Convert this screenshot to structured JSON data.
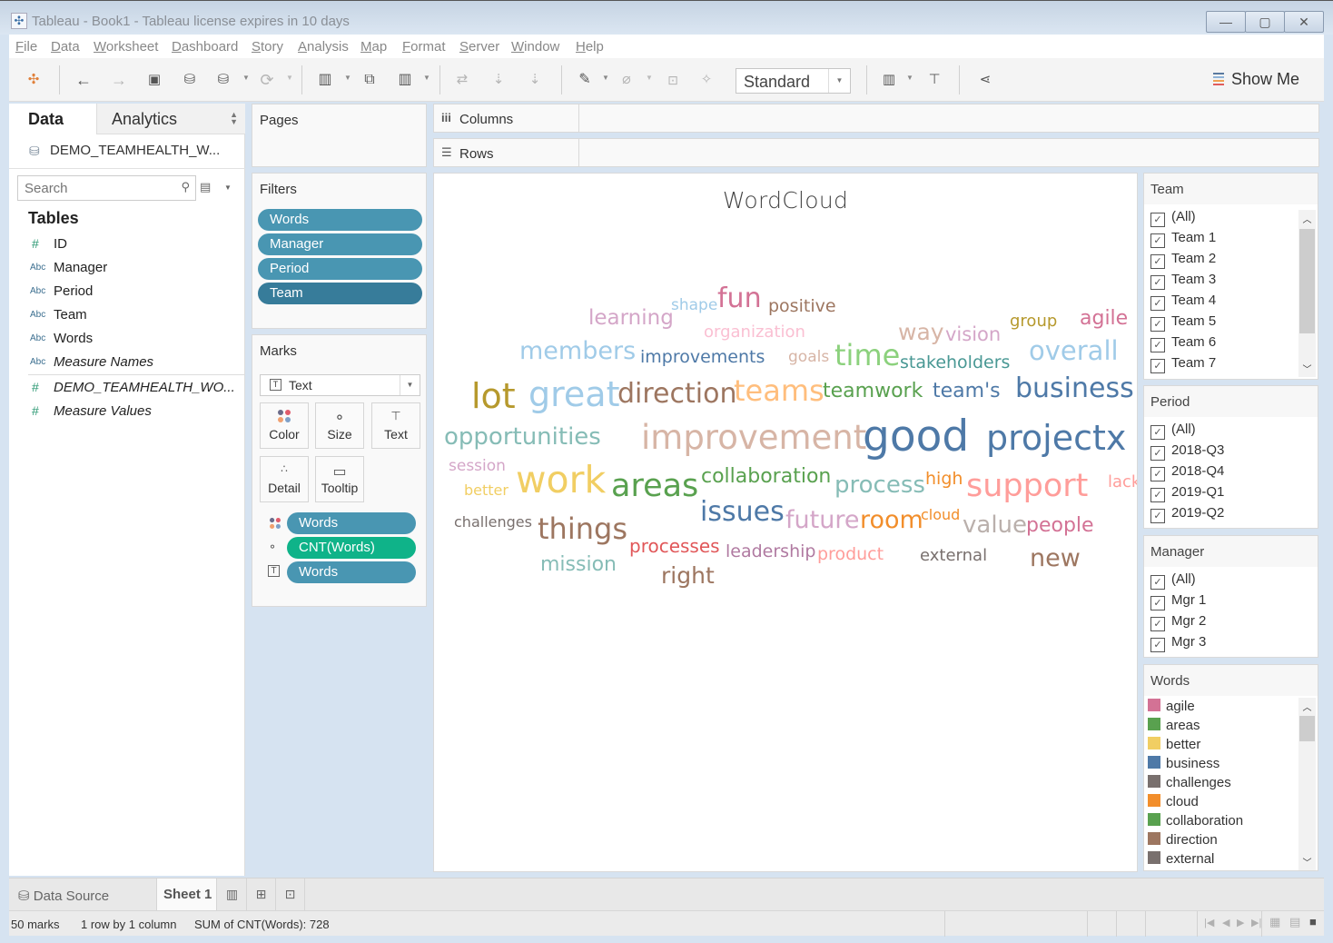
{
  "window": {
    "title": "Tableau - Book1 - Tableau license expires in 10 days",
    "app_icon": "tableau-logo-icon",
    "controls": [
      "minimize",
      "maximize",
      "close"
    ]
  },
  "menu": [
    "File",
    "Data",
    "Worksheet",
    "Dashboard",
    "Story",
    "Analysis",
    "Map",
    "Format",
    "Server",
    "Window",
    "Help"
  ],
  "toolbar": {
    "icons": [
      "tableau-logo-icon",
      "undo-icon",
      "redo-icon",
      "save-icon",
      "new-datasource-icon",
      "pause-updates-icon",
      "refresh-icon",
      "new-worksheet-icon",
      "duplicate-sheet-icon",
      "clear-sheet-icon",
      "swap-rows-columns-icon",
      "sort-ascending-icon",
      "sort-descending-icon",
      "highlight-icon",
      "group-icon",
      "label-icon",
      "pin-icon",
      "show-cards-icon",
      "presentation-icon",
      "share-icon"
    ],
    "fit_value": "Standard",
    "show_me_label": "Show Me"
  },
  "data_pane": {
    "tab_data": "Data",
    "tab_analytics": "Analytics",
    "datasource": "DEMO_TEAMHEALTH_W...",
    "search_placeholder": "Search",
    "tables_label": "Tables",
    "fields": [
      {
        "type": "#",
        "name": "ID",
        "italic": false,
        "kind": "measure"
      },
      {
        "type": "Abc",
        "name": "Manager",
        "italic": false,
        "kind": "dimension"
      },
      {
        "type": "Abc",
        "name": "Period",
        "italic": false,
        "kind": "dimension"
      },
      {
        "type": "Abc",
        "name": "Team",
        "italic": false,
        "kind": "dimension"
      },
      {
        "type": "Abc",
        "name": "Words",
        "italic": false,
        "kind": "dimension"
      },
      {
        "type": "Abc",
        "name": "Measure Names",
        "italic": true,
        "kind": "dimension"
      },
      {
        "type": "#",
        "name": "DEMO_TEAMHEALTH_WO...",
        "italic": true,
        "kind": "measure"
      },
      {
        "type": "#",
        "name": "Measure Values",
        "italic": true,
        "kind": "measure"
      }
    ]
  },
  "pages": {
    "title": "Pages"
  },
  "filters": {
    "title": "Filters",
    "pills": [
      "Words",
      "Manager",
      "Period",
      "Team"
    ]
  },
  "marks": {
    "title": "Marks",
    "mark_type": "Text",
    "buttons": [
      "Color",
      "Size",
      "Text",
      "Detail",
      "Tooltip"
    ],
    "encodings": [
      {
        "icon": "color-icon",
        "field": "Words"
      },
      {
        "icon": "size-icon",
        "field": "CNT(Words)"
      },
      {
        "icon": "text-icon",
        "field": "Words"
      }
    ]
  },
  "shelves": {
    "columns": "Columns",
    "rows": "Rows"
  },
  "viz": {
    "title": "WordCloud"
  },
  "chart_data": {
    "type": "wordcloud",
    "title": "WordCloud",
    "size_measure": "CNT(Words)",
    "color_dimension": "Words",
    "total": 728,
    "mark_count": 50,
    "words": [
      {
        "text": "good",
        "weight": 48,
        "color": "#4e79a7"
      },
      {
        "text": "projectx",
        "weight": 40,
        "color": "#4e79a7"
      },
      {
        "text": "improvement",
        "weight": 36,
        "color": "#d7b5a6"
      },
      {
        "text": "work",
        "weight": 36,
        "color": "#f1ce63"
      },
      {
        "text": "great",
        "weight": 34,
        "color": "#a0cbe8"
      },
      {
        "text": "lot",
        "weight": 34,
        "color": "#b6992d"
      },
      {
        "text": "areas",
        "weight": 34,
        "color": "#59a14f"
      },
      {
        "text": "support",
        "weight": 32,
        "color": "#ff9d9a"
      },
      {
        "text": "business",
        "weight": 28,
        "color": "#4e79a7"
      },
      {
        "text": "teams",
        "weight": 30,
        "color": "#ffbe7d"
      },
      {
        "text": "direction",
        "weight": 30,
        "color": "#9d7660"
      },
      {
        "text": "time",
        "weight": 30,
        "color": "#8cd17d"
      },
      {
        "text": "overall",
        "weight": 28,
        "color": "#a0cbe8"
      },
      {
        "text": "things",
        "weight": 30,
        "color": "#9d7660"
      },
      {
        "text": "issues",
        "weight": 28,
        "color": "#4e79a7"
      },
      {
        "text": "members",
        "weight": 26,
        "color": "#a0cbe8"
      },
      {
        "text": "opportunities",
        "weight": 26,
        "color": "#86bcb6"
      },
      {
        "text": "fun",
        "weight": 28,
        "color": "#d37295"
      },
      {
        "text": "process",
        "weight": 26,
        "color": "#86bcb6"
      },
      {
        "text": "room",
        "weight": 26,
        "color": "#f28e2b"
      },
      {
        "text": "future",
        "weight": 26,
        "color": "#d4a6c8"
      },
      {
        "text": "value",
        "weight": 26,
        "color": "#bab0ac"
      },
      {
        "text": "new",
        "weight": 26,
        "color": "#9d7660"
      },
      {
        "text": "right",
        "weight": 24,
        "color": "#9d7660"
      },
      {
        "text": "way",
        "weight": 24,
        "color": "#d7b5a6"
      },
      {
        "text": "learning",
        "weight": 22,
        "color": "#d4a6c8"
      },
      {
        "text": "agile",
        "weight": 22,
        "color": "#d37295"
      },
      {
        "text": "teamwork",
        "weight": 22,
        "color": "#59a14f"
      },
      {
        "text": "team's",
        "weight": 22,
        "color": "#4e79a7"
      },
      {
        "text": "mission",
        "weight": 22,
        "color": "#86bcb6"
      },
      {
        "text": "collaboration",
        "weight": 22,
        "color": "#59a14f"
      },
      {
        "text": "people",
        "weight": 22,
        "color": "#d37295"
      },
      {
        "text": "processes",
        "weight": 20,
        "color": "#e15759"
      },
      {
        "text": "vision",
        "weight": 20,
        "color": "#d4a6c8"
      },
      {
        "text": "positive",
        "weight": 19,
        "color": "#9d7660"
      },
      {
        "text": "stakeholders",
        "weight": 19,
        "color": "#499894"
      },
      {
        "text": "improvements",
        "weight": 19,
        "color": "#4e79a7"
      },
      {
        "text": "leadership",
        "weight": 19,
        "color": "#b07aa1"
      },
      {
        "text": "product",
        "weight": 19,
        "color": "#ff9d9a"
      },
      {
        "text": "external",
        "weight": 18,
        "color": "#79706e"
      },
      {
        "text": "group",
        "weight": 18,
        "color": "#b6992d"
      },
      {
        "text": "organization",
        "weight": 18,
        "color": "#fabfd2"
      },
      {
        "text": "high",
        "weight": 18,
        "color": "#f28e2b"
      },
      {
        "text": "lack",
        "weight": 18,
        "color": "#ff9d9a"
      },
      {
        "text": "session",
        "weight": 17,
        "color": "#d4a6c8"
      },
      {
        "text": "shape",
        "weight": 17,
        "color": "#a0cbe8"
      },
      {
        "text": "goals",
        "weight": 17,
        "color": "#d7b5a6"
      },
      {
        "text": "challenges",
        "weight": 16,
        "color": "#79706e"
      },
      {
        "text": "cloud",
        "weight": 16,
        "color": "#f28e2b"
      },
      {
        "text": "better",
        "weight": 16,
        "color": "#f1ce63"
      }
    ]
  },
  "quick_filters": {
    "team": {
      "title": "Team",
      "items": [
        "(All)",
        "Team 1",
        "Team 2",
        "Team 3",
        "Team 4",
        "Team 5",
        "Team 6",
        "Team 7"
      ],
      "checked": true
    },
    "period": {
      "title": "Period",
      "items": [
        "(All)",
        "2018-Q3",
        "2018-Q4",
        "2019-Q1",
        "2019-Q2"
      ],
      "checked": true
    },
    "manager": {
      "title": "Manager",
      "items": [
        "(All)",
        "Mgr 1",
        "Mgr 2",
        "Mgr 3"
      ],
      "checked": true
    }
  },
  "color_legend": {
    "title": "Words",
    "items": [
      {
        "label": "agile",
        "color": "#d37295"
      },
      {
        "label": "areas",
        "color": "#59a14f"
      },
      {
        "label": "better",
        "color": "#f1ce63"
      },
      {
        "label": "business",
        "color": "#4e79a7"
      },
      {
        "label": "challenges",
        "color": "#79706e"
      },
      {
        "label": "cloud",
        "color": "#f28e2b"
      },
      {
        "label": "collaboration",
        "color": "#59a14f"
      },
      {
        "label": "direction",
        "color": "#9d7660"
      },
      {
        "label": "external",
        "color": "#79706e"
      }
    ]
  },
  "sheet_tabs": {
    "data_source": "Data Source",
    "sheet": "Sheet 1",
    "new_icons": [
      "new-worksheet-icon",
      "new-dashboard-icon",
      "new-story-icon"
    ]
  },
  "status": {
    "marks": "50 marks",
    "dims": "1 row by 1 column",
    "sum": "SUM of CNT(Words): 728"
  },
  "colors": {
    "pill_blue": "#4996b2",
    "pill_dark_blue": "#377c9a",
    "pill_green": "#0fb389"
  }
}
